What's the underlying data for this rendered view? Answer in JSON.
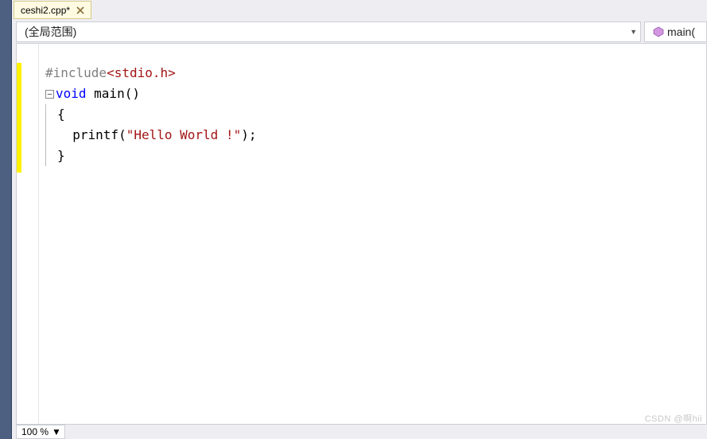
{
  "tab": {
    "label": "ceshi2.cpp*"
  },
  "scope_dropdown": {
    "label": "(全局范围)"
  },
  "func_dropdown": {
    "label": "main("
  },
  "code": {
    "include_kw": "#include",
    "include_hdr": "<stdio.h>",
    "void_kw": "void",
    "main_decl": " main()",
    "open_brace": "{",
    "printf": "  printf(",
    "printf_str": "\"Hello World !\"",
    "printf_end": ");",
    "close_brace": "}"
  },
  "status": {
    "zoom": "100 %"
  },
  "watermark": "CSDN @啊hii"
}
